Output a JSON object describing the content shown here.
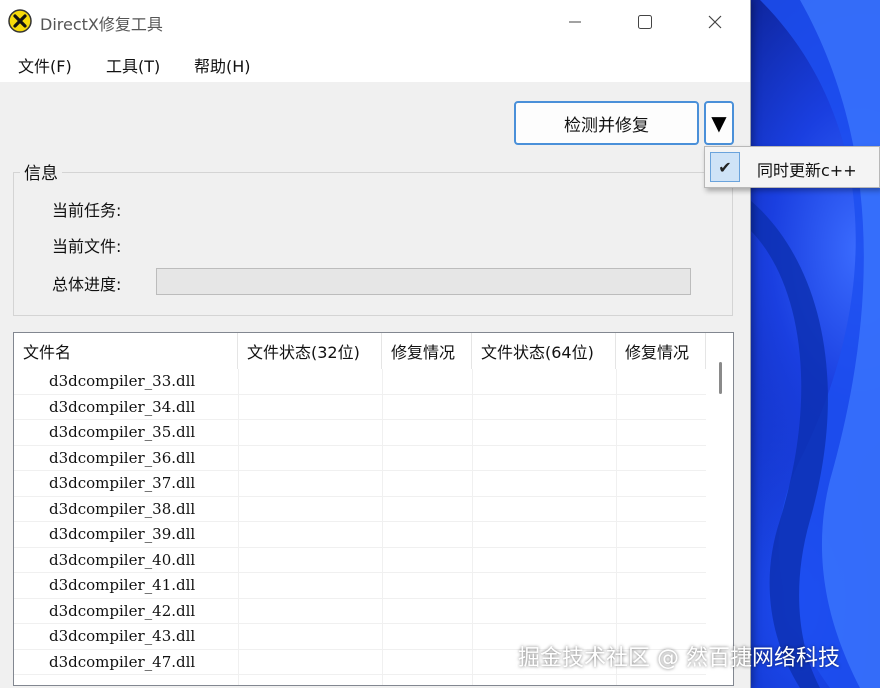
{
  "window": {
    "title": "DirectX修复工具",
    "controls": {
      "minimize": "─",
      "maximize": "☐",
      "close": "✕"
    }
  },
  "menu": [
    {
      "label": "文件(F)"
    },
    {
      "label": "工具(T)"
    },
    {
      "label": "帮助(H)"
    }
  ],
  "toolbar": {
    "main_button": "检测并修复",
    "dropdown_glyph": "▼",
    "dropdown_menu": {
      "check_glyph": "✔",
      "item_label": "同时更新c++",
      "checked": true
    }
  },
  "info_group": {
    "title": "信息",
    "current_task_label": "当前任务:",
    "current_file_label": "当前文件:",
    "overall_progress_label": "总体进度:",
    "progress_value": 0
  },
  "file_list": {
    "columns": [
      "文件名",
      "文件状态(32位)",
      "修复情况",
      "文件状态(64位)",
      "修复情况"
    ],
    "rows": [
      {
        "name": "d3dcompiler_33.dll"
      },
      {
        "name": "d3dcompiler_34.dll"
      },
      {
        "name": "d3dcompiler_35.dll"
      },
      {
        "name": "d3dcompiler_36.dll"
      },
      {
        "name": "d3dcompiler_37.dll"
      },
      {
        "name": "d3dcompiler_38.dll"
      },
      {
        "name": "d3dcompiler_39.dll"
      },
      {
        "name": "d3dcompiler_40.dll"
      },
      {
        "name": "d3dcompiler_41.dll"
      },
      {
        "name": "d3dcompiler_42.dll"
      },
      {
        "name": "d3dcompiler_43.dll"
      },
      {
        "name": "d3dcompiler_47.dll"
      }
    ]
  },
  "watermark": "掘金技术社区 @ 然百捷网络科技",
  "colors": {
    "accent": "#4a90d9",
    "check_bg": "#cfe3f7",
    "app_icon_yellow": "#f5d90a"
  }
}
